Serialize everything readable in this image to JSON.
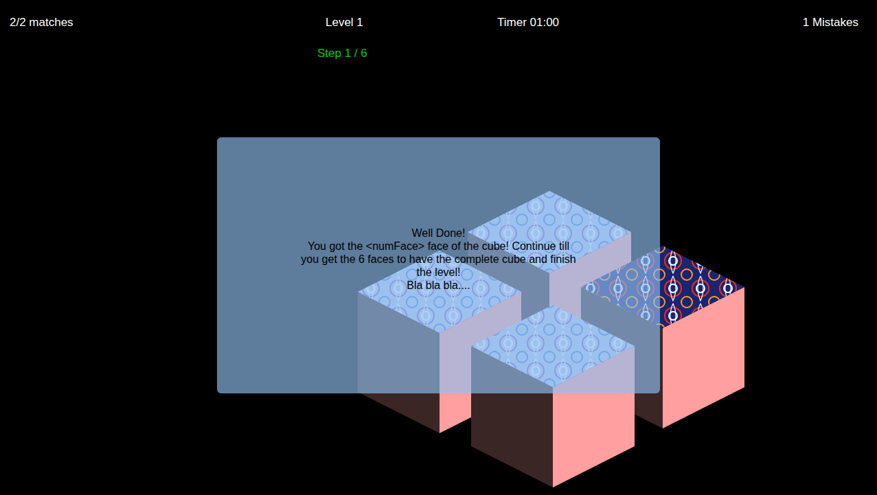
{
  "hud": {
    "matches": "2/2 matches",
    "level": "Level 1",
    "timer": "Timer 01:00",
    "mistakes": "1 Mistakes",
    "step": "Step 1 / 6"
  },
  "cubes": [
    {
      "color": "#b4c6ee"
    },
    {
      "color": "#b4c6ee"
    },
    {
      "color": "#1c2470"
    },
    {
      "color": "#b4c6ee"
    }
  ],
  "dialog": {
    "lines": [
      "Well Done!",
      "You got the <numFace> face of the cube! Continue till",
      "you get the 6 faces to have the complete cube and finish",
      "the level!",
      "Bla bla bla...."
    ]
  }
}
